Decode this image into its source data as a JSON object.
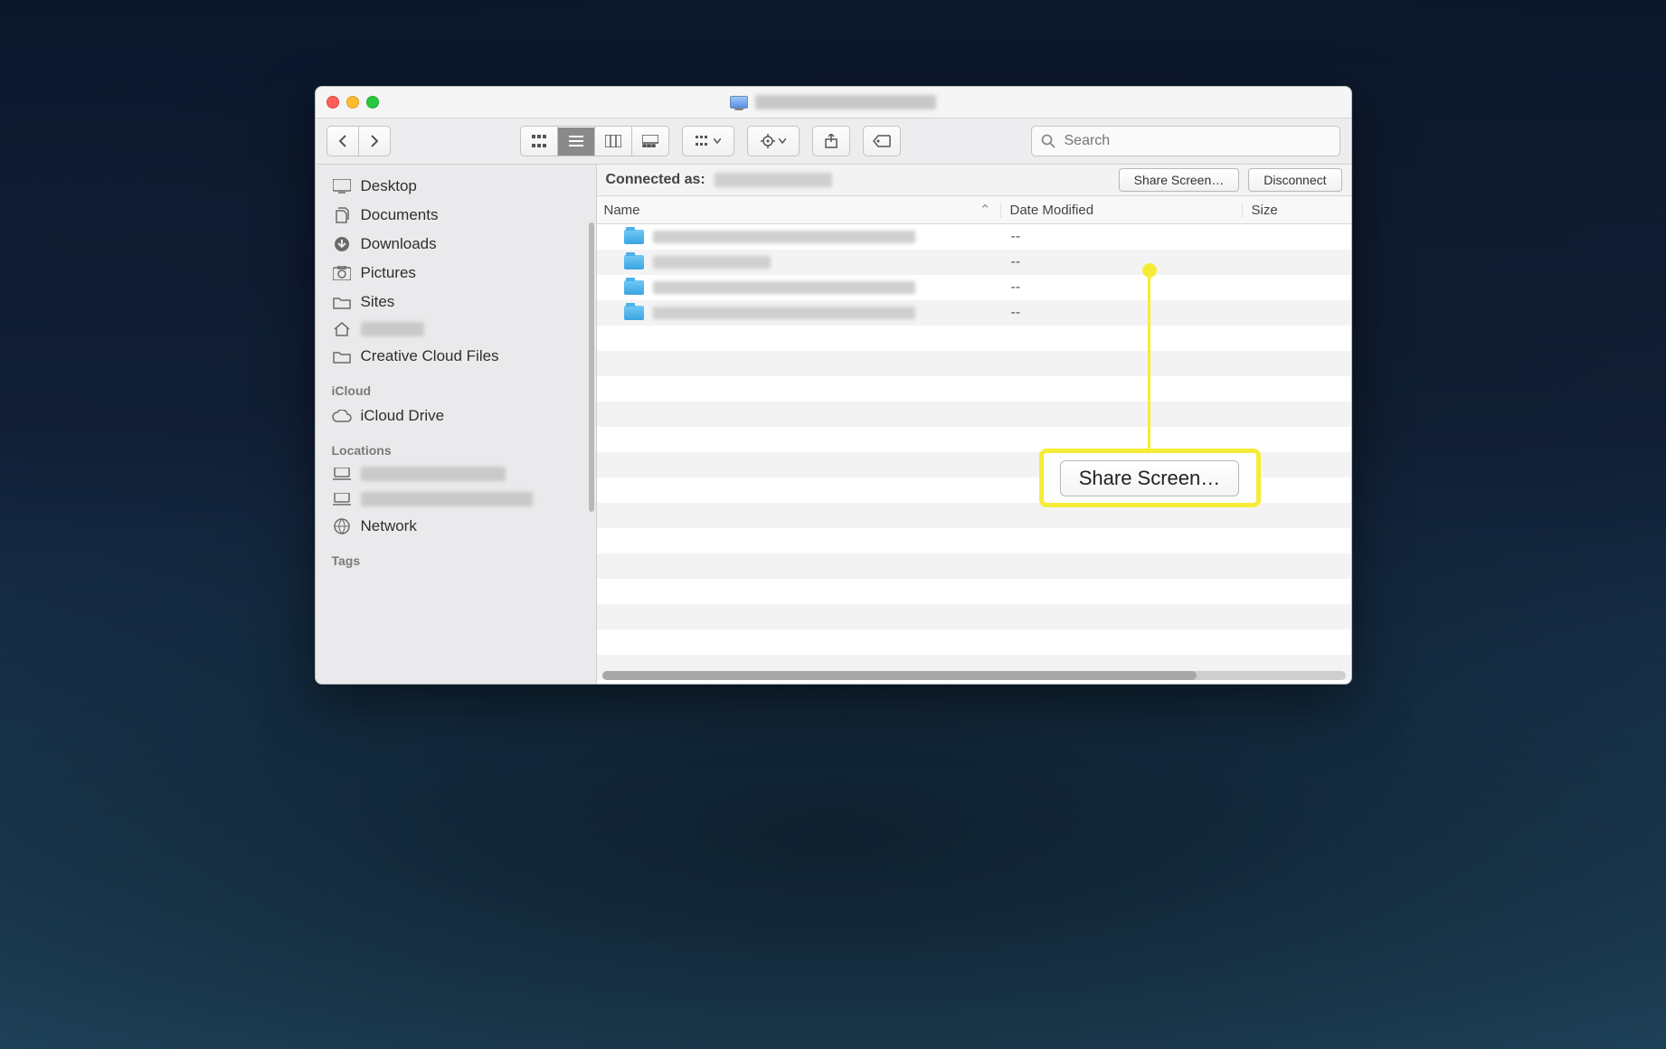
{
  "window": {
    "title_redacted": true
  },
  "toolbar": {
    "search_placeholder": "Search",
    "active_view": "list"
  },
  "sidebar": {
    "favorites": [
      {
        "icon": "desktop",
        "label": "Desktop"
      },
      {
        "icon": "documents",
        "label": "Documents"
      },
      {
        "icon": "downloads",
        "label": "Downloads"
      },
      {
        "icon": "pictures",
        "label": "Pictures"
      },
      {
        "icon": "sites",
        "label": "Sites"
      },
      {
        "icon": "home",
        "label": "",
        "redacted": true,
        "redact_w": 70
      },
      {
        "icon": "folder",
        "label": "Creative Cloud Files"
      }
    ],
    "sections": {
      "icloud_label": "iCloud",
      "icloud_items": [
        {
          "icon": "cloud",
          "label": "iCloud Drive"
        }
      ],
      "locations_label": "Locations",
      "locations_items": [
        {
          "icon": "laptop",
          "label": "",
          "redacted": true,
          "redact_w": 160
        },
        {
          "icon": "laptop",
          "label": "",
          "redacted": true,
          "redact_w": 190
        },
        {
          "icon": "globe",
          "label": "Network"
        }
      ],
      "tags_label": "Tags"
    }
  },
  "conn_bar": {
    "label": "Connected as:",
    "share_screen_label": "Share Screen…",
    "disconnect_label": "Disconnect"
  },
  "columns": {
    "name": "Name",
    "date": "Date Modified",
    "size": "Size"
  },
  "rows": [
    {
      "name_redact_w": 290,
      "date": "--",
      "size": ""
    },
    {
      "name_redact_w": 130,
      "date": "--",
      "size": ""
    },
    {
      "name_redact_w": 290,
      "date": "--",
      "size": ""
    },
    {
      "name_redact_w": 290,
      "date": "--",
      "size": ""
    }
  ],
  "callout": {
    "label": "Share Screen…"
  }
}
